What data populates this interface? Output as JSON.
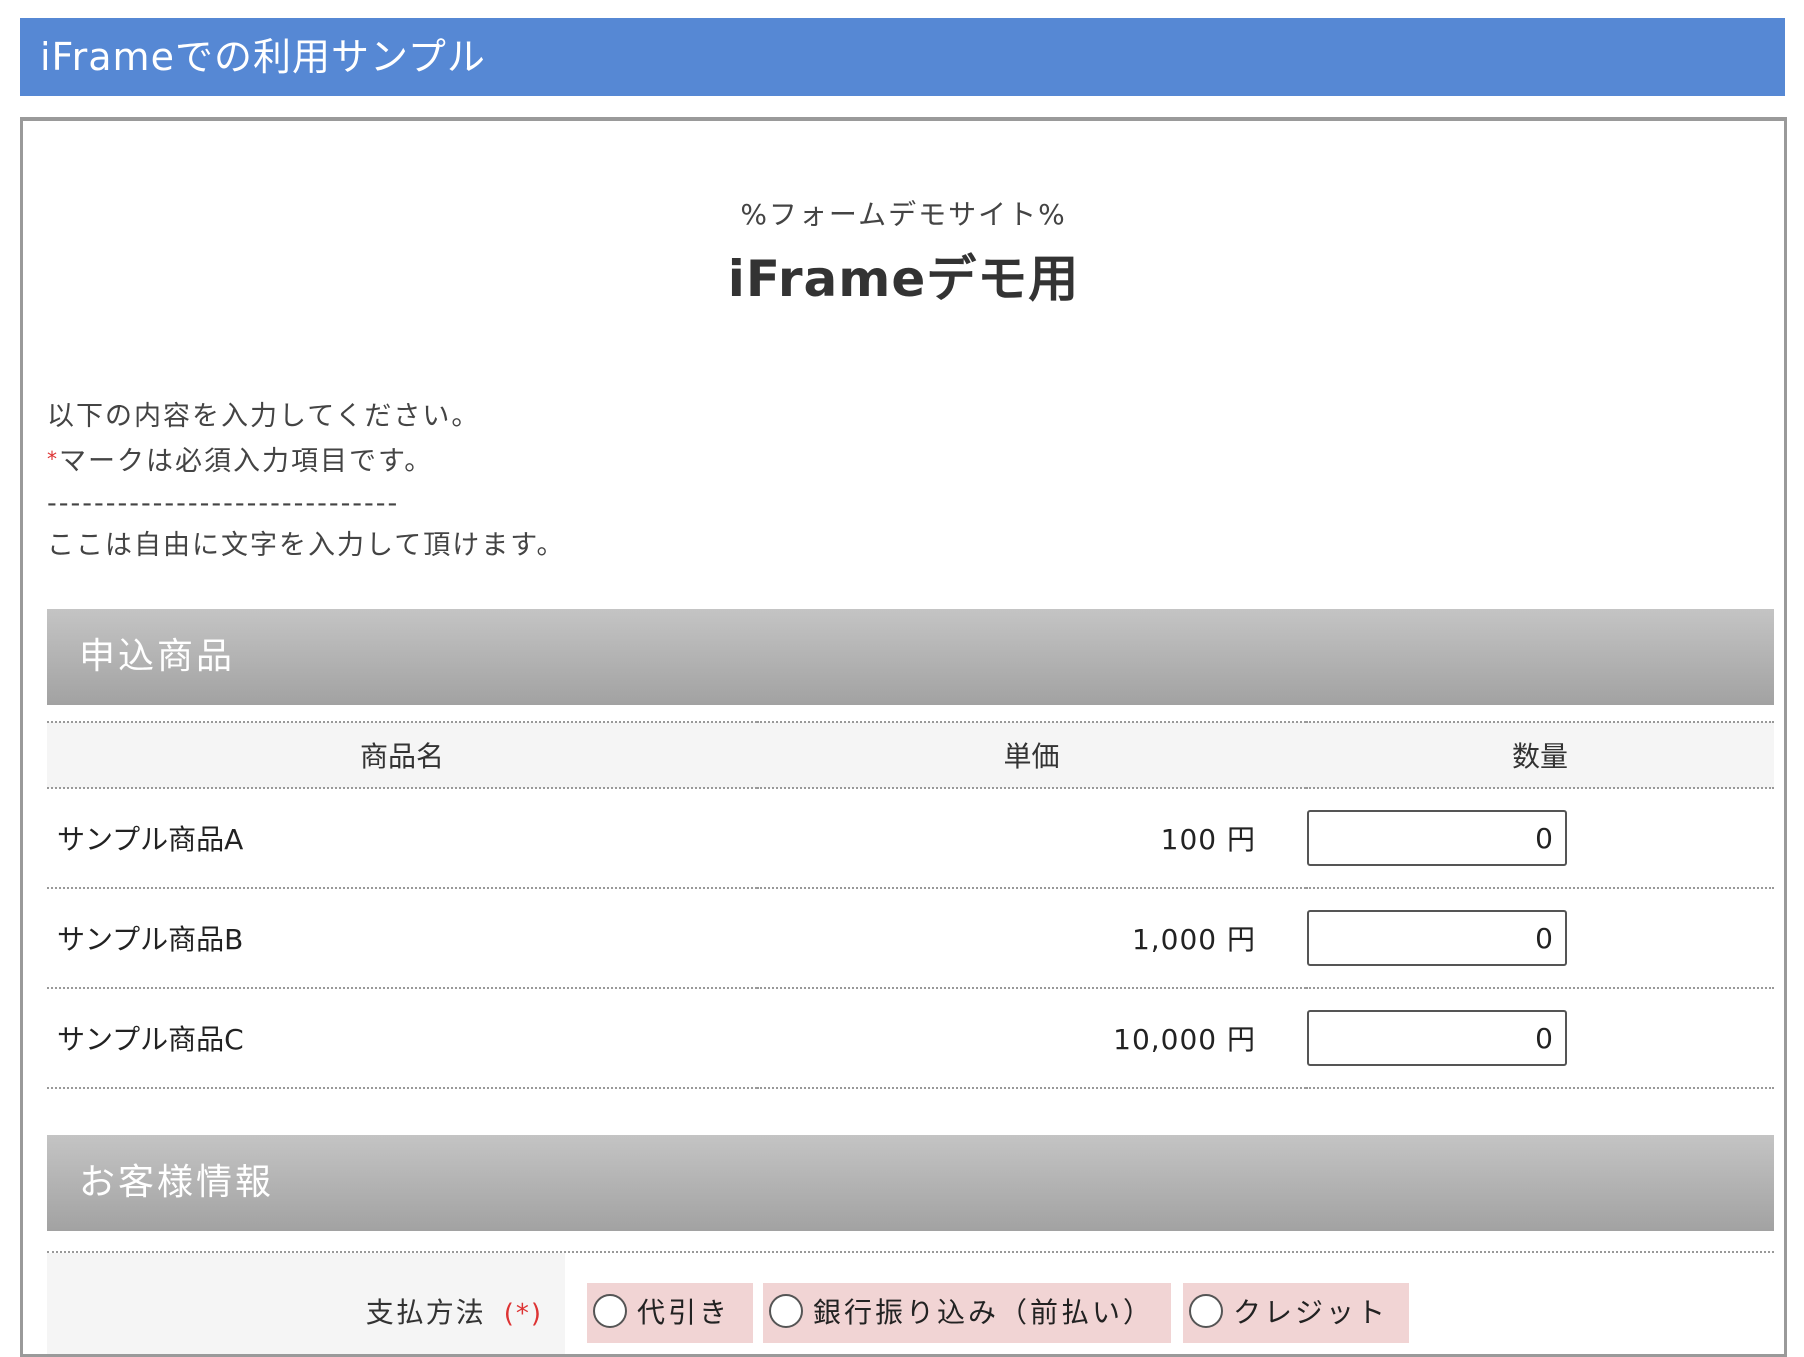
{
  "window": {
    "title": "iFrameでの利用サンプル"
  },
  "form": {
    "site_name": "%フォームデモサイト%",
    "title": "iFrameデモ用",
    "intro": {
      "line1": "以下の内容を入力してください。",
      "req_mark": "*",
      "line2": "マークは必須入力項目です。",
      "divider": "------------------------------",
      "line3": "ここは自由に文字を入力して頂けます。"
    },
    "sections": {
      "products": "申込商品",
      "customer": "お客様情報"
    },
    "table": {
      "headers": {
        "name": "商品名",
        "price": "単価",
        "qty": "数量"
      },
      "rows": [
        {
          "name": "サンプル商品A",
          "price": "100 円",
          "qty": "0"
        },
        {
          "name": "サンプル商品B",
          "price": "1,000 円",
          "qty": "0"
        },
        {
          "name": "サンプル商品C",
          "price": "10,000 円",
          "qty": "0"
        }
      ]
    },
    "payment": {
      "label": "支払方法",
      "required": "(*)",
      "options": [
        "代引き",
        "銀行振り込み（前払い）",
        "クレジット"
      ]
    }
  }
}
